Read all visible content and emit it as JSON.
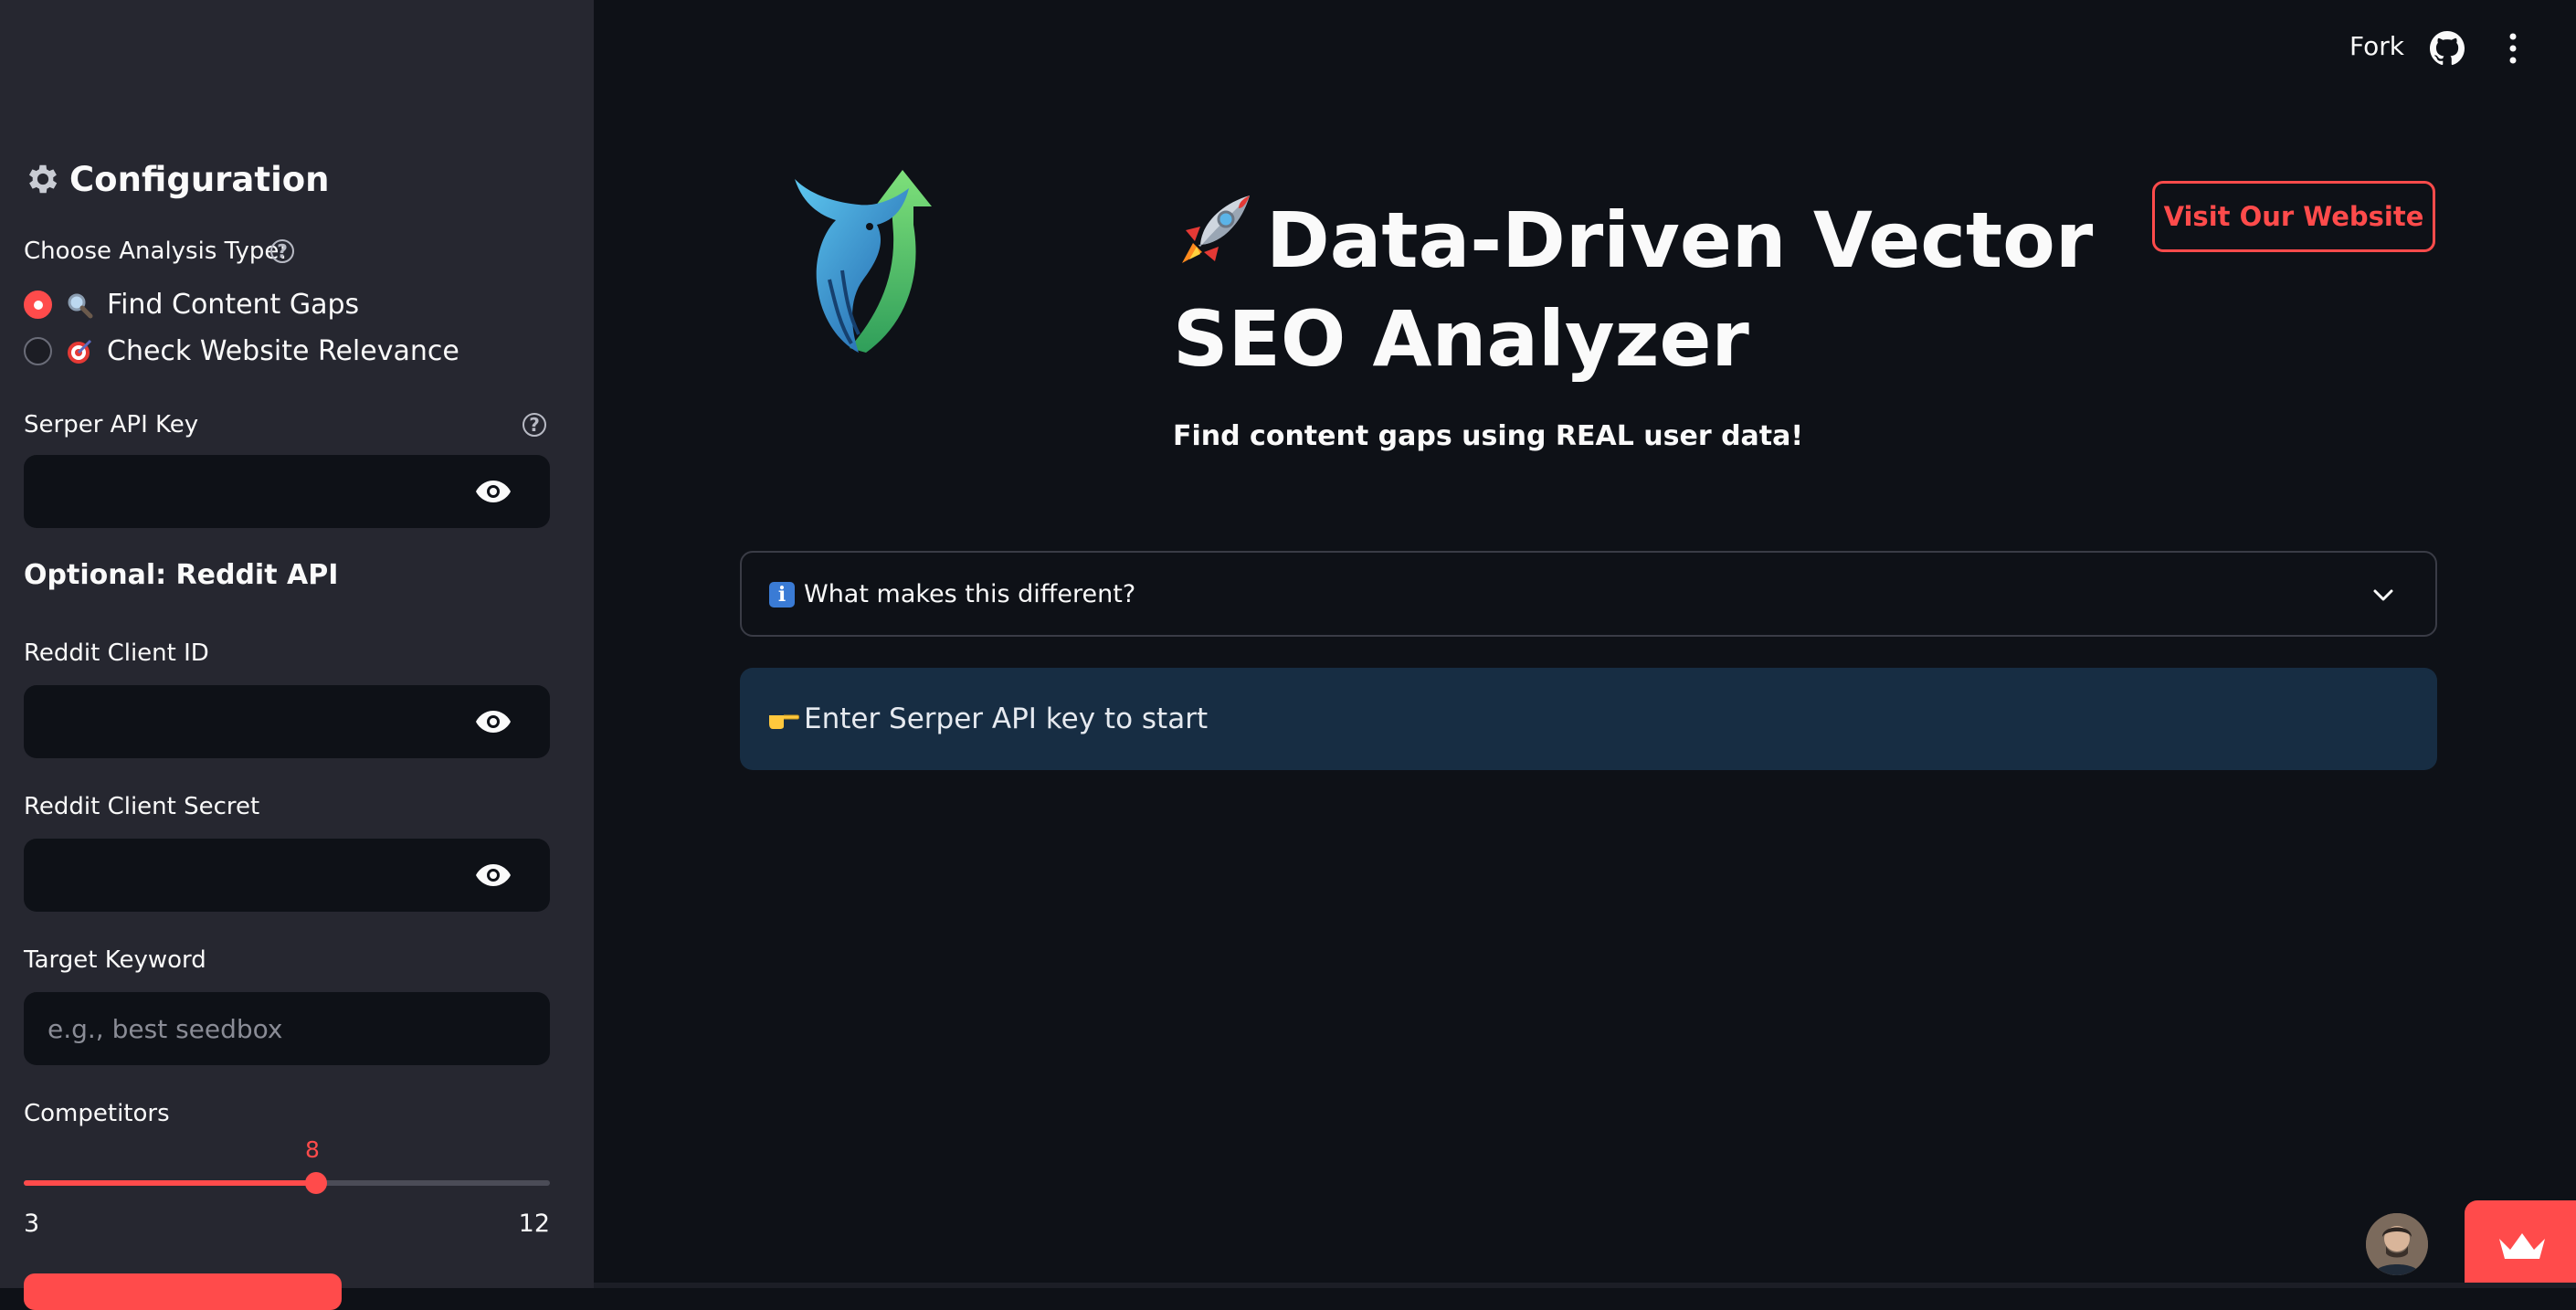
{
  "header": {
    "fork_label": "Fork",
    "github_icon": "github-icon",
    "menu_icon": "more-vertical-icon"
  },
  "sidebar": {
    "title": "Configuration",
    "title_icon": "gear-icon",
    "analysis": {
      "label": "Choose Analysis Type:",
      "options": [
        {
          "icon": "magnifier-icon",
          "label": "Find Content Gaps",
          "selected": true
        },
        {
          "icon": "target-icon",
          "label": "Check Website Relevance",
          "selected": false
        }
      ]
    },
    "serper": {
      "label": "Serper API Key",
      "value": ""
    },
    "reddit_section": "Optional: Reddit API",
    "reddit_client_id": {
      "label": "Reddit Client ID",
      "value": ""
    },
    "reddit_client_secret": {
      "label": "Reddit Client Secret",
      "value": ""
    },
    "target_keyword": {
      "label": "Target Keyword",
      "placeholder": "e.g., best seedbox",
      "value": ""
    },
    "competitors": {
      "label": "Competitors",
      "value": "8",
      "min": "3",
      "max": "12"
    }
  },
  "main": {
    "logo_icon": "bull-arrow-logo",
    "title_icon": "rocket-icon",
    "title": "Data-Driven Vector SEO Analyzer",
    "subtitle": "Find content gaps using REAL user data!",
    "visit_button": "Visit Our Website",
    "expander": {
      "icon": "info-icon",
      "label": "What makes this different?"
    },
    "alert": {
      "icon": "pointing-hand-icon",
      "text": "Enter Serper API key to start"
    }
  },
  "colors": {
    "accent": "#ff4b4b",
    "background": "#0e1117",
    "sidebar": "#262730",
    "alert_bg": "#172d43"
  }
}
